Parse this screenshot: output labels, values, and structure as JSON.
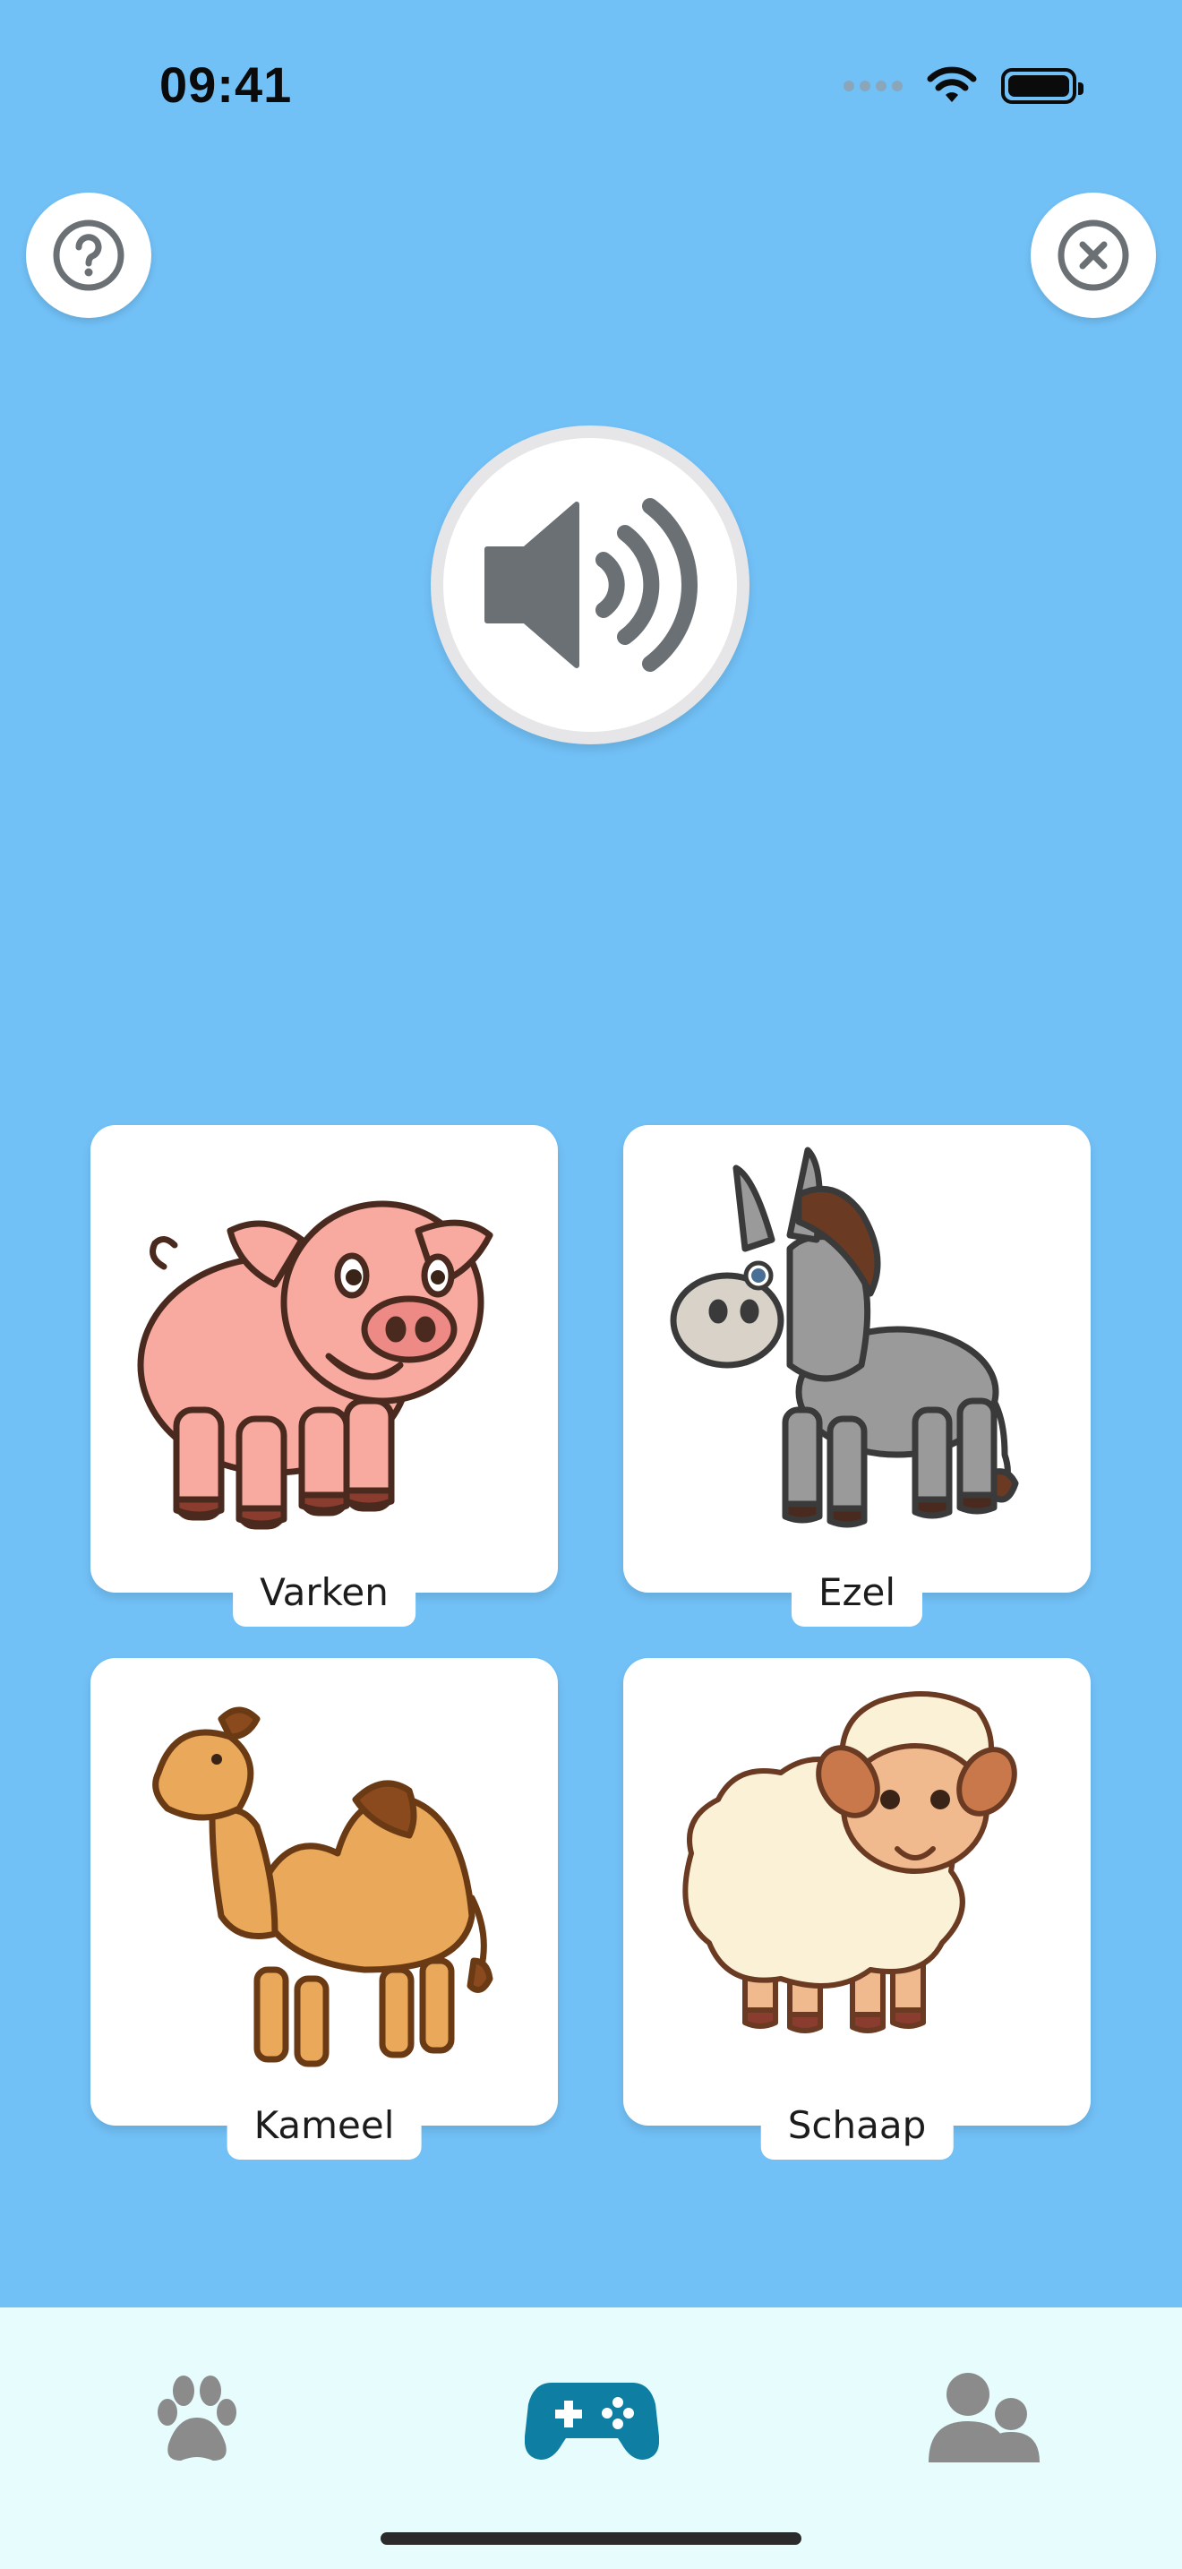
{
  "status_bar": {
    "time": "09:41"
  },
  "top_buttons": {
    "help_icon": "question-circle",
    "close_icon": "x-circle"
  },
  "speaker": {
    "icon": "speaker-wave-icon"
  },
  "cards": [
    {
      "label": "Varken",
      "animal": "pig"
    },
    {
      "label": "Ezel",
      "animal": "donkey"
    },
    {
      "label": "Kameel",
      "animal": "camel"
    },
    {
      "label": "Schaap",
      "animal": "sheep"
    }
  ],
  "tab_bar": {
    "tabs": [
      {
        "icon": "paw-icon",
        "active": false
      },
      {
        "icon": "gamepad-icon",
        "active": true
      },
      {
        "icon": "users-icon",
        "active": false
      }
    ],
    "active_color": "#0F7EA3",
    "inactive_color": "#8B8B8B"
  },
  "colors": {
    "background": "#71C0F6",
    "tab_bar_background": "#E6FCFD",
    "card_background": "#FFFFFF"
  }
}
